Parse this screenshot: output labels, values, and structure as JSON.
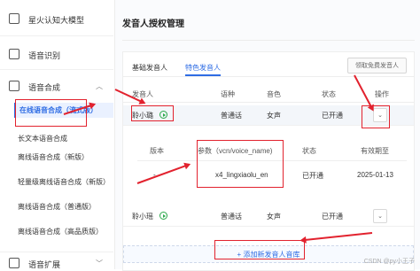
{
  "sidebar": {
    "items": [
      {
        "label": "星火认知大模型"
      },
      {
        "label": "语音识别"
      },
      {
        "label": "语音合成"
      },
      {
        "label": "语音扩展"
      }
    ],
    "sub_items": [
      {
        "label": "在线语音合成（流式版）"
      },
      {
        "label": "长文本语音合成"
      },
      {
        "label": "离线语音合成（新版）"
      },
      {
        "label": "轻量级离线语音合成（新版）"
      },
      {
        "label": "离线语音合成（普通版）"
      },
      {
        "label": "离线语音合成（高品质版）"
      }
    ]
  },
  "main": {
    "title": "发音人授权管理",
    "tabs": [
      {
        "label": "基础发音人"
      },
      {
        "label": "特色发音人"
      }
    ],
    "claim_button": "领取免费发音人",
    "table": {
      "headers": [
        "发音人",
        "语种",
        "音色",
        "状态",
        "操作"
      ],
      "rows": [
        {
          "voice": "聆小璐",
          "lang": "普通话",
          "tone": "女声",
          "status": "已开通",
          "action": "⌄"
        },
        {
          "voice": "聆小瑶",
          "lang": "普通话",
          "tone": "女声",
          "status": "已开通",
          "action": "⌄"
        }
      ]
    },
    "subtable": {
      "headers": [
        "版本",
        "参数（vcn/voice_name)",
        "状态",
        "有效期至"
      ],
      "values": [
        "-",
        "x4_lingxiaolu_en",
        "已开通",
        "2025-01-13"
      ]
    },
    "add_button": "+ 添加新发音人音库"
  },
  "watermark": "CSDN @py小王子",
  "colors": {
    "accent": "#2e6ce4",
    "annotation": "#e2222e",
    "success": "#2aa84a"
  }
}
